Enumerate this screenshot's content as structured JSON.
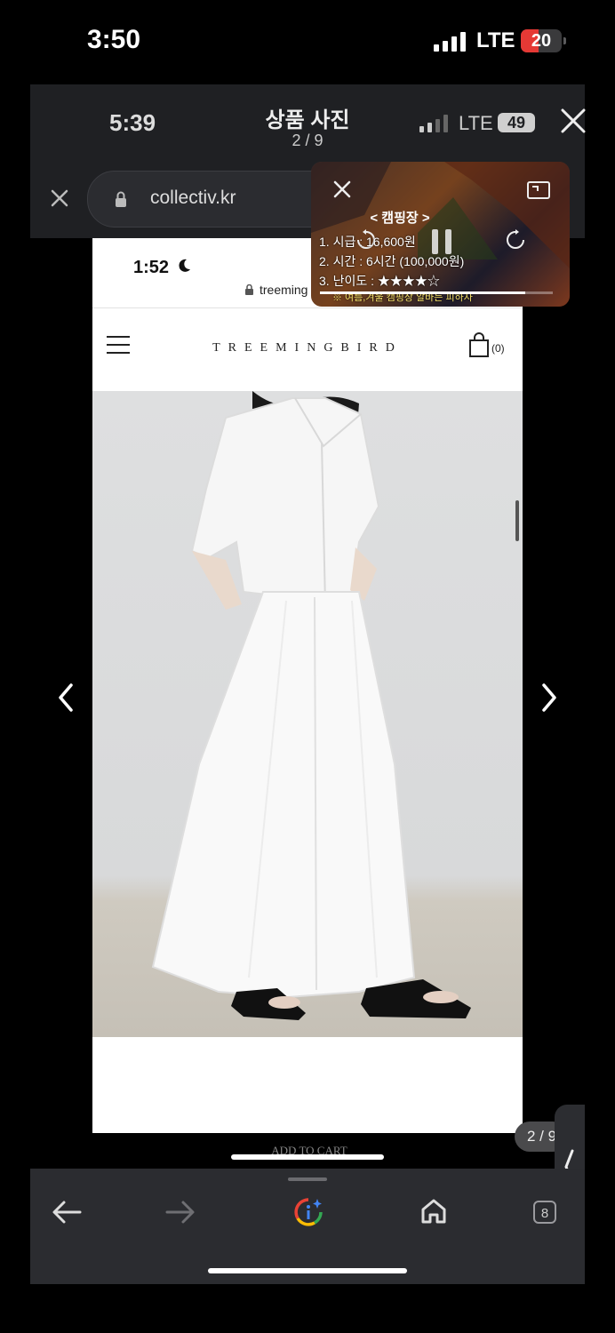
{
  "status_bar": {
    "time": "3:50",
    "network": "LTE",
    "battery": "20",
    "battery_level": 0.2
  },
  "viewer": {
    "time": "5:39",
    "title": "상품 사진",
    "counter": "2 / 9",
    "network": "LTE",
    "battery": "49"
  },
  "address_bar": {
    "url": "collectiv.kr"
  },
  "web_page": {
    "time": "1:52",
    "url": "treeming",
    "logo": "TREEMINGBIRD",
    "cart_count": "(0)",
    "add_to_cart": "ADD TO CART"
  },
  "pip": {
    "title": "< 캠핑장 >",
    "lines": [
      "1. 시급 : 16,600원",
      "2. 시간 : 6시간 (100,000원)",
      "3. 난이도 : ★★★★☆"
    ],
    "note": "※ 여름,겨울 캠핑장 알바는 피하자",
    "progress": 0.88
  },
  "overlay_counter": "2 / 9",
  "toolbar": {
    "tabs_count": "8"
  },
  "icons": [
    "close-icon",
    "lock-icon",
    "moon-icon",
    "menu-icon",
    "cart-icon",
    "chevron-left-icon",
    "chevron-right-icon",
    "back-arrow-icon",
    "forward-arrow-icon",
    "assistant-icon",
    "home-icon",
    "tabs-icon",
    "expand-icon",
    "rewind-icon",
    "pause-icon",
    "forward-icon"
  ]
}
